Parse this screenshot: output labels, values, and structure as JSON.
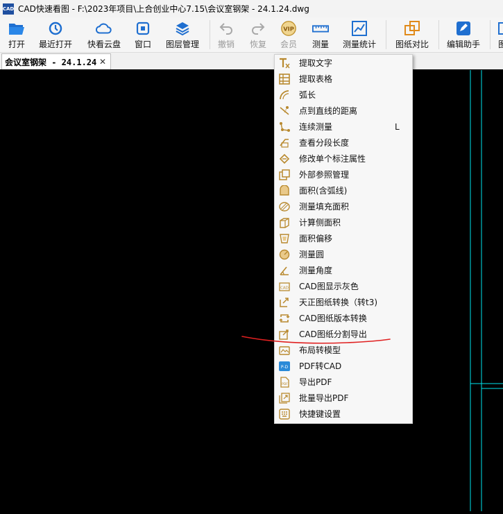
{
  "window": {
    "app_icon_text": "CAD",
    "title": "CAD快速看图 - F:\\2023年项目\\上合创业中心7.15\\会议室钢架 - 24.1.24.dwg"
  },
  "toolbar": {
    "items": [
      {
        "label": "打开",
        "icon": "folder-open-icon"
      },
      {
        "label": "最近打开",
        "icon": "recent-clock-icon"
      },
      {
        "label": "快看云盘",
        "icon": "cloud-icon"
      },
      {
        "label": "窗口",
        "icon": "window-icon"
      },
      {
        "label": "图层管理",
        "icon": "layers-icon"
      },
      {
        "label": "撤销",
        "icon": "undo-icon"
      },
      {
        "label": "恢复",
        "icon": "redo-icon"
      },
      {
        "label": "会员",
        "icon": "vip-icon",
        "badge": "VIP"
      },
      {
        "label": "测量",
        "icon": "ruler-icon"
      },
      {
        "label": "测量统计",
        "icon": "measure-stats-icon"
      },
      {
        "label": "图纸对比",
        "icon": "compare-icon"
      },
      {
        "label": "编辑助手",
        "icon": "edit-assistant-icon"
      },
      {
        "label": "图",
        "icon": "more-icon"
      }
    ]
  },
  "tab": {
    "label": "会议室钢架 - 24.1.24.dwg",
    "close": "✕"
  },
  "menu": {
    "items": [
      {
        "label": "提取文字",
        "icon": "extract-text-icon"
      },
      {
        "label": "提取表格",
        "icon": "extract-table-icon"
      },
      {
        "label": "弧长",
        "icon": "arc-length-icon"
      },
      {
        "label": "点到直线的距离",
        "icon": "point-line-distance-icon"
      },
      {
        "label": "连续测量",
        "icon": "continuous-measure-icon",
        "shortcut": "L"
      },
      {
        "label": "查看分段长度",
        "icon": "segment-length-icon"
      },
      {
        "label": "修改单个标注属性",
        "icon": "edit-dimension-icon"
      },
      {
        "label": "外部参照管理",
        "icon": "xref-icon"
      },
      {
        "label": "面积(含弧线)",
        "icon": "area-arc-icon"
      },
      {
        "label": "测量填充面积",
        "icon": "hatch-area-icon"
      },
      {
        "label": "计算侧面积",
        "icon": "side-area-icon"
      },
      {
        "label": "面积偏移",
        "icon": "area-offset-icon"
      },
      {
        "label": "测量圆",
        "icon": "circle-measure-icon"
      },
      {
        "label": "测量角度",
        "icon": "angle-icon"
      },
      {
        "label": "CAD图显示灰色",
        "icon": "gray-display-icon"
      },
      {
        "label": "天正图纸转换（转t3)",
        "icon": "tangent-convert-icon"
      },
      {
        "label": "CAD图纸版本转换",
        "icon": "version-convert-icon"
      },
      {
        "label": "CAD图纸分割导出",
        "icon": "split-export-icon"
      },
      {
        "label": "布局转模型",
        "icon": "layout-model-icon"
      },
      {
        "label": "PDF转CAD",
        "icon": "pdf-to-cad-icon"
      },
      {
        "label": "导出PDF",
        "icon": "export-pdf-icon"
      },
      {
        "label": "批量导出PDF",
        "icon": "batch-pdf-icon"
      },
      {
        "label": "快捷键设置",
        "icon": "shortcut-settings-icon"
      }
    ]
  },
  "colors": {
    "accent_blue": "#1f6fd0",
    "menu_icon": "#b8892e",
    "cad_line": "#00e5ee",
    "annotation": "#e02020"
  }
}
